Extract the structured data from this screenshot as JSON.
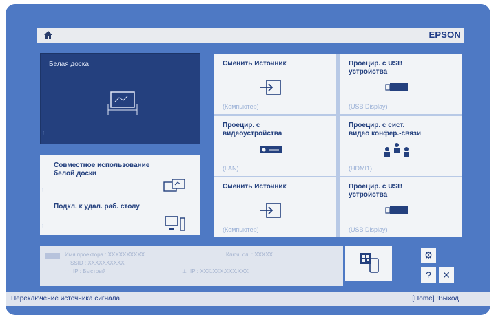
{
  "header": {
    "brand": "EPSON",
    "home_icon": "home-icon"
  },
  "whiteboard": {
    "label": "Белая доска",
    "icon": "whiteboard-icon"
  },
  "share": {
    "label1": "Совместное использование\nбелой доски",
    "label2": "Подкл. к удал. раб. столу",
    "icon1": "shared-whiteboard-icon",
    "icon2": "remote-desktop-icon"
  },
  "tiles": [
    {
      "title": "Сменить Источник",
      "sub": "(Компьютер)",
      "icon": "input-source-icon"
    },
    {
      "title": "Проецир. с USB\nустройства",
      "sub": "(USB Display)",
      "icon": "usb-icon"
    },
    {
      "title": "Проецир. с\nвидеоустройства",
      "sub": "(LAN)",
      "icon": "projector-icon"
    },
    {
      "title": "Проецир. с сист.\nвидео конфер.-связи",
      "sub": "(HDMI1)",
      "icon": "conference-icon"
    },
    {
      "title": "Сменить Источник",
      "sub": "(Компьютер)",
      "icon": "input-source-icon"
    },
    {
      "title": "Проецир. с USB\nустройства",
      "sub": "(USB Display)",
      "icon": "usb-icon"
    }
  ],
  "info": {
    "projector_name": "Имя проектора : XXXXXXXXXX",
    "ssid": "SSID   :  XXXXXXXXXX",
    "ip_quick": "IP  :  Быстрый",
    "keyword": "Ключ. сл. : XXXXX",
    "ip_addr": "IP  :  XXX.XXX.XXX.XXX"
  },
  "buttons": {
    "settings": "⚙",
    "help": "?",
    "close": "✕"
  },
  "footer": {
    "status": "Переключение источника сигнала.",
    "hint": "[Home] :Выход"
  },
  "colors": {
    "background": "#4e79c4",
    "accent": "#24407e",
    "tile": "#f2f4f7"
  }
}
